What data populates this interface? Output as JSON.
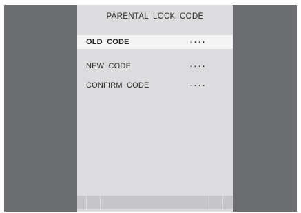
{
  "screen": {
    "title": "PARENTAL LOCK CODE"
  },
  "fields": [
    {
      "label": "OLD  CODE",
      "value": "....",
      "selected": true
    },
    {
      "label": "NEW CODE",
      "value": "....",
      "selected": false
    },
    {
      "label": "CONFIRM  CODE",
      "value": "....",
      "selected": false
    }
  ],
  "colors": {
    "background_frame": "#6c6d70",
    "panel": "#dcdcde",
    "highlight": "#f4f4f5"
  }
}
